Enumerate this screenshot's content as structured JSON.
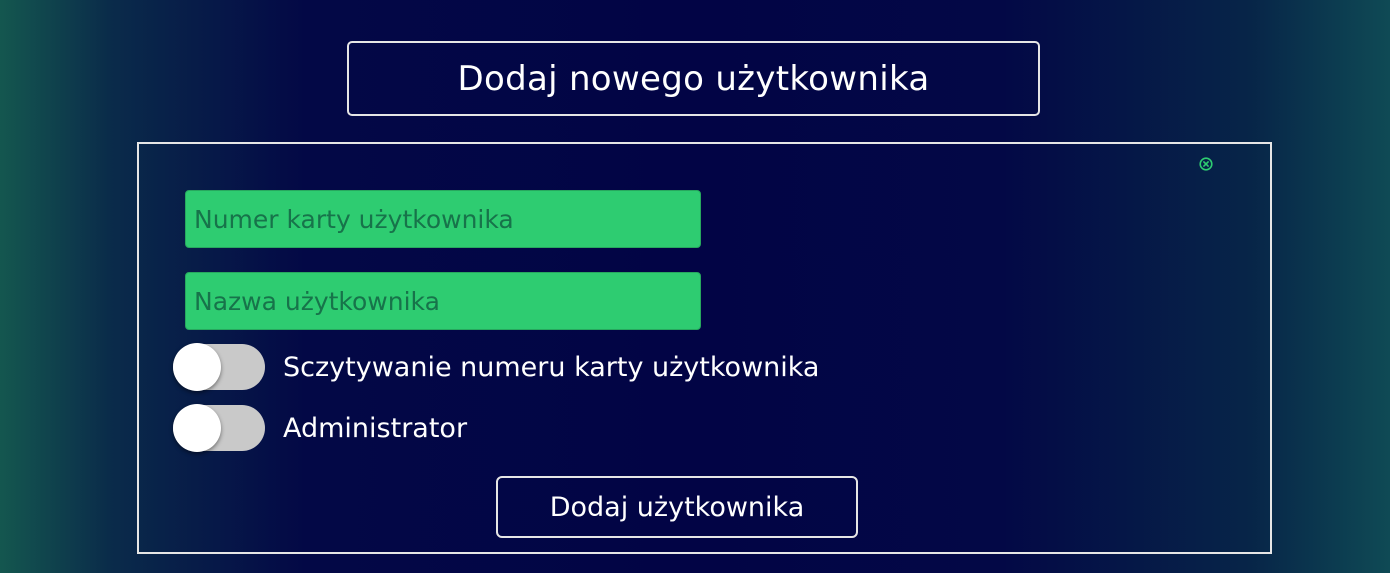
{
  "header": {
    "title": "Dodaj nowego użytkownika"
  },
  "form": {
    "close_icon": "close-circle-icon",
    "card_number_field": {
      "placeholder": "Numer karty użytkownika",
      "value": ""
    },
    "username_field": {
      "placeholder": "Nazwa użytkownika",
      "value": ""
    },
    "toggles": [
      {
        "label": "Sczytywanie numeru karty użytkownika",
        "checked": false
      },
      {
        "label": "Administrator",
        "checked": false
      }
    ],
    "submit_label": "Dodaj użytkownika"
  },
  "colors": {
    "background": "#020445",
    "accent": "#2ecc71",
    "border": "#e6e6e6",
    "toggle_track_off": "#c9c9c9",
    "text": "#ffffff"
  }
}
